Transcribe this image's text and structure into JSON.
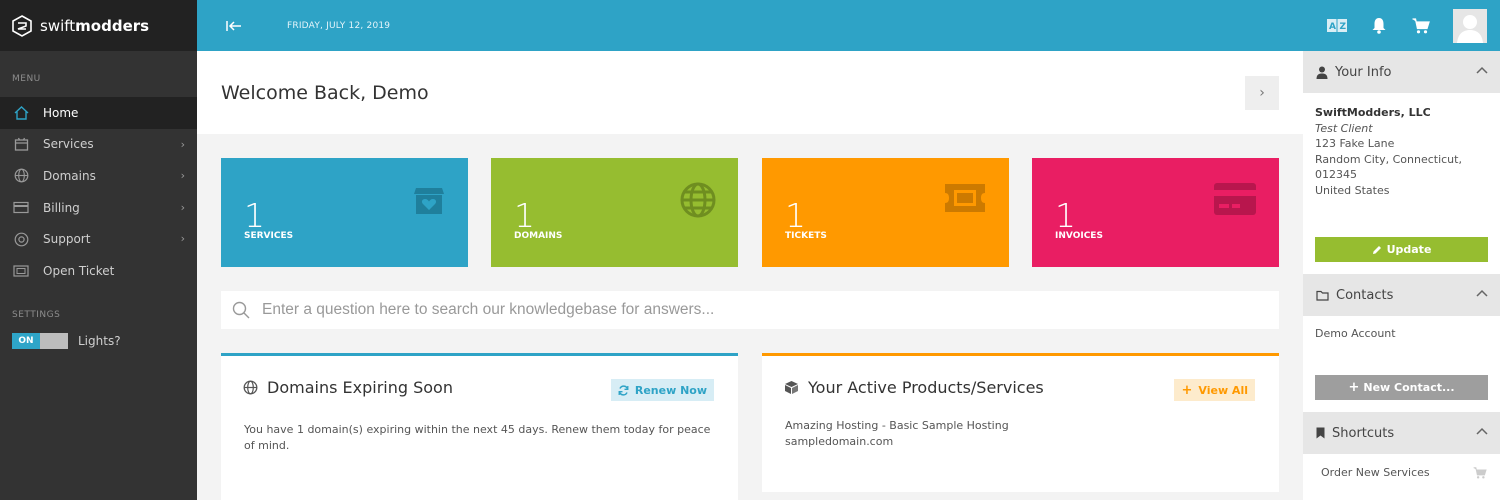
{
  "brand": {
    "name_light": "swift",
    "name_bold": "modders"
  },
  "sidebar": {
    "menu_label": "MENU",
    "items": [
      {
        "label": "Home",
        "icon": "home-icon",
        "active": true
      },
      {
        "label": "Services",
        "icon": "box-icon",
        "submenu": true
      },
      {
        "label": "Domains",
        "icon": "globe-icon",
        "submenu": true
      },
      {
        "label": "Billing",
        "icon": "credit-card-icon",
        "submenu": true
      },
      {
        "label": "Support",
        "icon": "lifebuoy-icon",
        "submenu": true
      },
      {
        "label": "Open Ticket",
        "icon": "ticket-icon"
      }
    ],
    "settings_label": "SETTINGS",
    "lights_toggle": {
      "state": "ON",
      "label": "Lights?"
    }
  },
  "topbar": {
    "date": "FRIDAY, JULY 12, 2019",
    "icons": [
      "collapse-icon",
      "translate-icon",
      "bell-icon",
      "cart-icon",
      "avatar"
    ]
  },
  "welcome": {
    "title": "Welcome Back, Demo"
  },
  "tiles": [
    {
      "count": "1",
      "label": "SERVICES",
      "color": "#2ea3c6",
      "icon": "box-heart-icon"
    },
    {
      "count": "1",
      "label": "DOMAINS",
      "color": "#96bd30",
      "icon": "globe-icon"
    },
    {
      "count": "1",
      "label": "TICKETS",
      "color": "#ff9900",
      "icon": "ticket-icon"
    },
    {
      "count": "1",
      "label": "INVOICES",
      "color": "#e91e63",
      "icon": "credit-card-icon"
    }
  ],
  "search": {
    "placeholder": "Enter a question here to search our knowledgebase for answers..."
  },
  "panels": {
    "domains": {
      "title": "Domains Expiring Soon",
      "button": "Renew Now",
      "body": "You have 1 domain(s) expiring within the next 45 days. Renew them today for peace of mind.",
      "accent": "#2ea3c6"
    },
    "products": {
      "title": "Your Active Products/Services",
      "button": "View All",
      "line1": "Amazing Hosting - Basic Sample Hosting",
      "line2": "sampledomain.com",
      "accent": "#ff9900"
    }
  },
  "right": {
    "your_info": {
      "title": "Your Info",
      "company": "SwiftModders, LLC",
      "client": "Test Client",
      "address1": "123 Fake Lane",
      "address2": "Random City, Connecticut,",
      "zip": "012345",
      "country": "United States",
      "button": "Update"
    },
    "contacts": {
      "title": "Contacts",
      "item": "Demo Account",
      "button": "New Contact..."
    },
    "shortcuts": {
      "title": "Shortcuts",
      "item": "Order New Services"
    }
  }
}
